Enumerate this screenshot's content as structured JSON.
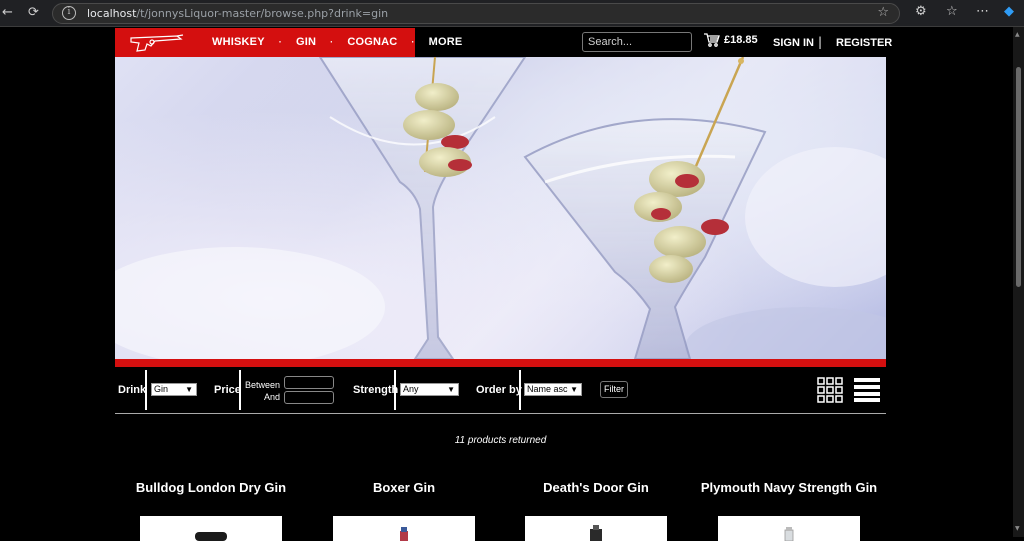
{
  "browser": {
    "url_host": "localhost",
    "url_path": "/t/jonnysLiquor-master/browse.php?drink=gin"
  },
  "nav": {
    "menu": [
      "WHISKEY",
      "GIN",
      "COGNAC",
      "MORE"
    ],
    "search_placeholder": "Search...",
    "cart_total": "£18.85",
    "sign_in": "SIGN IN",
    "separator": "|",
    "register": "REGISTER"
  },
  "filters": {
    "drink_label": "Drink",
    "drink_value": "Gin",
    "price_label": "Price",
    "between_label": "Between",
    "and_label": "And",
    "strength_label": "Strength",
    "strength_value": "Any",
    "order_label": "Order by",
    "order_value": "Name asc",
    "filter_button": "Filter"
  },
  "results": {
    "count_text": "11 products returned"
  },
  "products": [
    {
      "name": "Bulldog London Dry Gin"
    },
    {
      "name": "Boxer Gin"
    },
    {
      "name": "Death's Door Gin"
    },
    {
      "name": "Plymouth Navy Strength Gin"
    }
  ],
  "colors": {
    "brand_red": "#d40f0f",
    "background": "#000000"
  }
}
